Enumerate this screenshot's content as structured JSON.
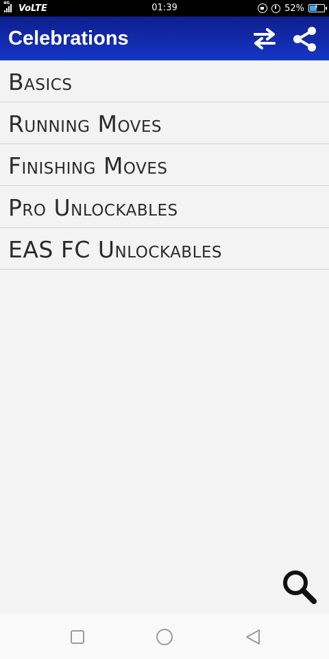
{
  "status_bar": {
    "network": "4G",
    "carrier": "VoLTE",
    "time": "01:39",
    "battery_level": 0.52,
    "battery_text": "52%"
  },
  "app_bar": {
    "title": "Celebrations",
    "color_top": "#0f1e8c",
    "color_bottom": "#1536c6",
    "icons": [
      "swap-arrows-icon",
      "share-icon"
    ]
  },
  "categories": [
    {
      "label": "Basics"
    },
    {
      "label": "Running Moves"
    },
    {
      "label": "Finishing Moves"
    },
    {
      "label": "Pro Unlockables"
    },
    {
      "label": "EAS FC Unlockables"
    }
  ],
  "search": {
    "icon": "search-icon"
  },
  "nav_bar": {
    "icons": [
      "recents-square-icon",
      "home-circle-icon",
      "back-triangle-icon"
    ]
  }
}
